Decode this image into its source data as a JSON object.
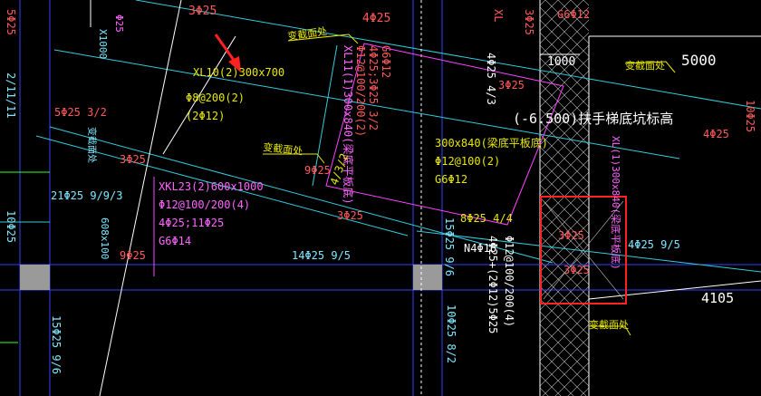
{
  "colors": {
    "background": "#000000",
    "rebar_label": "#ff5a5a",
    "beam_label": "#e8e800",
    "dimension": "#ffffff",
    "gridline": "#3344ff",
    "annotation_box": "#ff2222"
  },
  "labels": {
    "top_3phi25": "3Φ25",
    "top_4phi25": "4Φ25",
    "kink_1": "变截面处",
    "kink_2": "变截面处",
    "kink_3": "变截面处",
    "kink_4": "变截面处",
    "xl10_title": "XL10(2)300x700",
    "xl10_stirrup": "Φ8@200(2)",
    "xl10_waist": "(2Φ12)",
    "left_5phi25": "5Φ25 3/2",
    "mid_3phi25_a": "3Φ25",
    "mid_9phi25": "9Φ25",
    "mid_3phi25_b": "3Φ25",
    "xkl23_title": "XKL23(2)600x1000",
    "xkl23_stirrup": "Φ12@100/200(4)",
    "xkl23_bars": "4Φ25;11Φ25",
    "xkl23_waist": "G6Φ14",
    "left_9phi25": "9Φ25",
    "bottom_14phi25": "14Φ25 9/5",
    "left_21phi25": "21Φ25 9/9/3",
    "left_608": "608x100",
    "left_15phi25": "15Φ25 9/6",
    "left_10phi25": "10Φ25",
    "left_11": "2/11/11",
    "left_5phi": "5Φ25",
    "xl11_title": "XL11(1)300x840(梁底平板底)",
    "xl11_stirrup": "Φ12@100/200(2)",
    "xl11_bars": "4Φ25;3Φ25 3/2",
    "xl11_waist": "G6Φ12",
    "spec_300x840": "300x840(梁底平板底)",
    "spec_stirrup": "Φ12@100(2)",
    "spec_waist": "G6Φ12",
    "right_8phi25": "8Φ25 4/4",
    "right_413_2": "4/3/2",
    "col_15phi25": "15Φ25 9/6",
    "col_4phi25": "4Φ25 4/3",
    "col_3phi25": "3Φ25",
    "col_n4phi16": "N4Φ16",
    "col_4phi25b": "4Φ25+(2Φ12)5Φ25",
    "col_stirrup": "Φ12@100/200(4)",
    "col_10phi25": "10Φ25 8/2",
    "dim_1000": "1000",
    "dim_5000": "5000",
    "elev_label": "(-6.500)扶手梯底坑标高",
    "right_4phi25": "4Φ25 9/5",
    "dim_4105": "4105",
    "hl_3phi25_a": "3Φ25",
    "hl_3phi25_b": "3Φ25",
    "far_right_10phi25": "10Φ25",
    "far_right_4phi25": "4Φ25",
    "far_right_xl": "XL(1)300x840(梁底平板底)",
    "top_xl_c": "XL",
    "top_phi25": "Φ25",
    "top_g6": "G6Φ12",
    "top_3phi25_col": "3Φ25",
    "top_x1": "X1000"
  }
}
